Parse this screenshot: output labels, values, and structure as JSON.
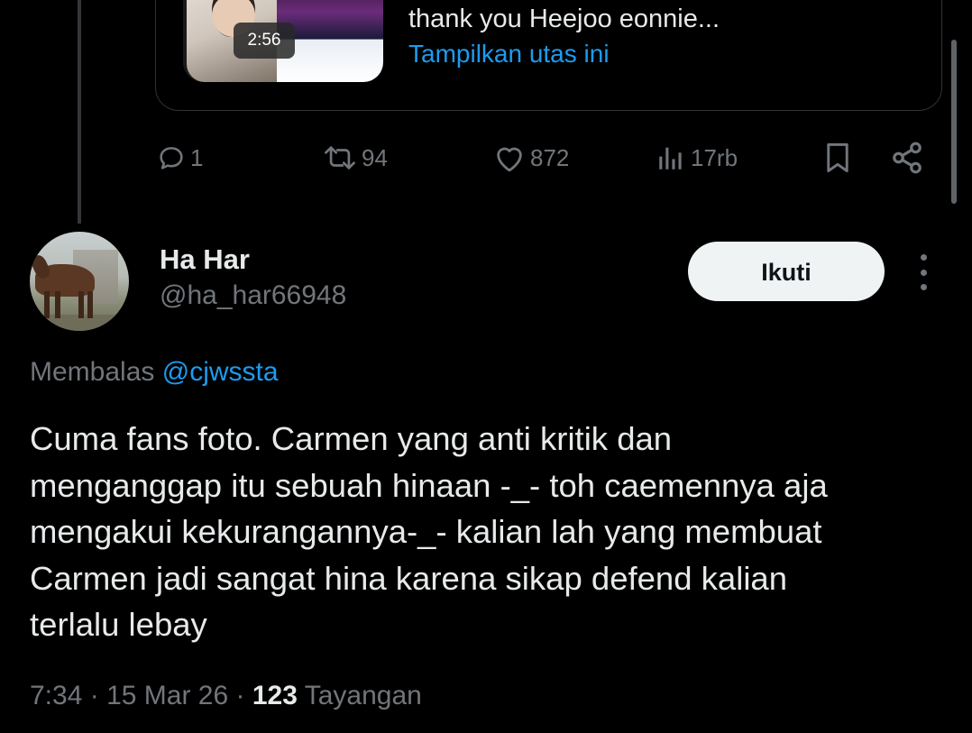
{
  "quoted_tweet": {
    "video_duration": "2:56",
    "text": "thank you Heejoo eonnie...",
    "show_thread_link": "Tampilkan utas ini"
  },
  "actions": {
    "replies": "1",
    "retweets": "94",
    "likes": "872",
    "views": "17rb"
  },
  "reply": {
    "display_name": "Ha Har",
    "handle": "@ha_har66948",
    "follow_label": "Ikuti",
    "replying_to_label": "Membalas",
    "replying_to_mention": "@cjwssta",
    "body_lines": [
      "Cuma fans foto. Carmen yang anti kritik dan",
      "menganggap itu sebuah hinaan -_- toh caemennya aja",
      "mengakui kekurangannya-_- kalian lah yang membuat",
      "Carmen jadi sangat hina karena sikap defend kalian",
      "terlalu lebay"
    ],
    "time": "7:34",
    "date": "15 Mar 26",
    "views_count": "123",
    "views_label": "Tayangan"
  },
  "colors": {
    "background": "#000000",
    "text_primary": "#e7e9ea",
    "text_secondary": "#71767b",
    "accent": "#1d9bf0",
    "follow_button_bg": "#eff3f4"
  }
}
